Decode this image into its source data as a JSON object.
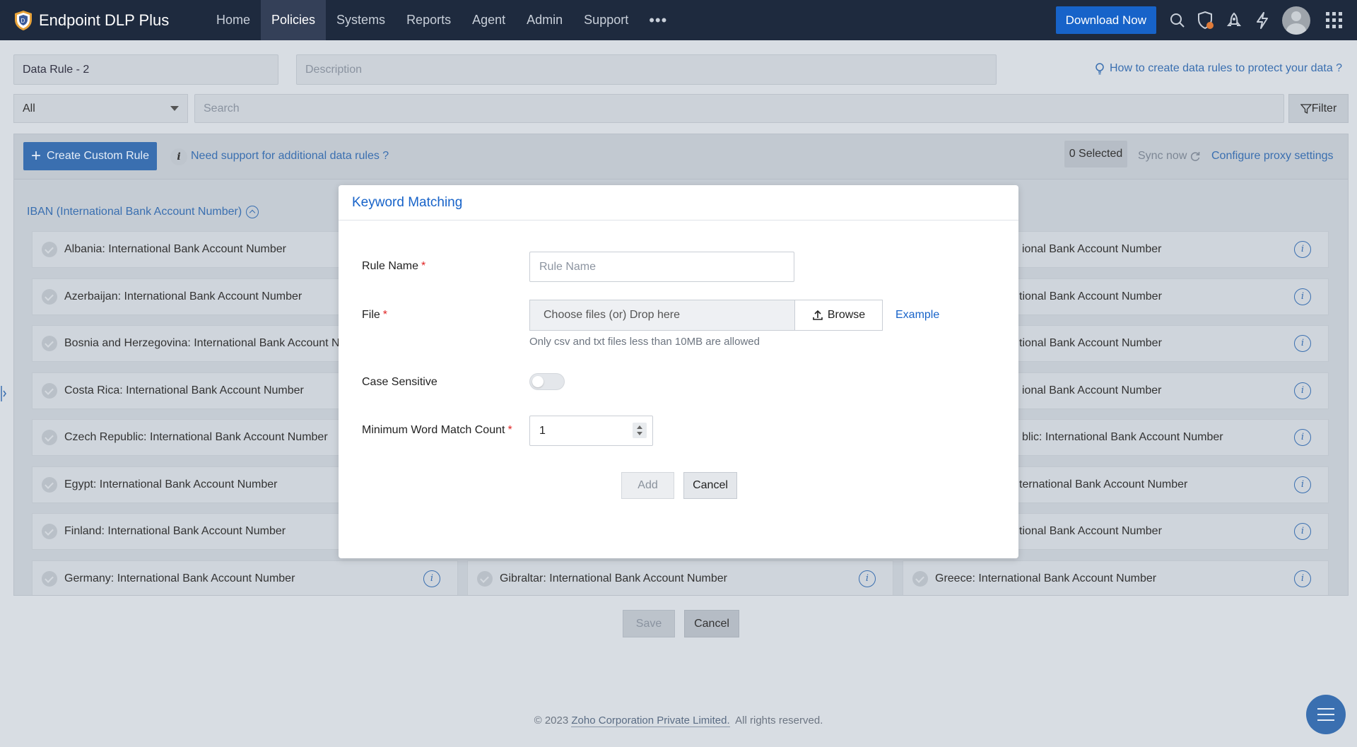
{
  "app": {
    "name": "Endpoint DLP Plus",
    "nav": [
      "Home",
      "Policies",
      "Systems",
      "Reports",
      "Agent",
      "Admin",
      "Support"
    ],
    "active_nav": "Policies",
    "more_label": "•••",
    "download_label": "Download Now",
    "icons": [
      "search-icon",
      "shield-alert-icon",
      "rocket-icon",
      "lightning-icon",
      "avatar",
      "app-grid-icon"
    ]
  },
  "rule_form": {
    "rule_name_value": "Data Rule - 2",
    "description_placeholder": "Description",
    "help_link": "How to create data rules to protect your data ?",
    "category_select": "All",
    "search_placeholder": "Search",
    "filter_label": "Filter"
  },
  "rules_panel": {
    "create_label": "Create Custom Rule",
    "info_label": "i",
    "support_link": "Need support for additional data rules ?",
    "selected_count": "0 Selected",
    "sync_label": "Sync now",
    "proxy_link": "Configure proxy settings",
    "section_title": "IBAN (International Bank Account Number)",
    "left_column": [
      "Albania: International Bank Account Number",
      "Azerbaijan: International Bank Account Number",
      "Bosnia and Herzegovina: International Bank Account N",
      "Costa Rica: International Bank Account Number",
      "Czech Republic: International Bank Account Number",
      "Egypt: International Bank Account Number",
      "Finland: International Bank Account Number",
      "Germany: International Bank Account Number"
    ],
    "middle_column_visible": [
      "Gibraltar: International Bank Account Number"
    ],
    "right_column": [
      "ional Bank Account Number",
      "tional Bank Account Number",
      "tional Bank Account Number",
      "ional Bank Account Number",
      "blic: International Bank Account Number",
      "ternational Bank Account Number",
      "tional Bank Account Number",
      "Greece: International Bank Account Number"
    ]
  },
  "page_actions": {
    "save": "Save",
    "cancel": "Cancel"
  },
  "footer": {
    "prefix": "© 2023 ",
    "company": "Zoho Corporation Private Limited.",
    "suffix": "  All rights reserved."
  },
  "modal": {
    "title": "Keyword Matching",
    "rule_name_label": "Rule Name",
    "rule_name_placeholder": "Rule Name",
    "file_label": "File",
    "file_drop_text": "Choose files (or) Drop here",
    "browse_label": "Browse",
    "example_link": "Example",
    "file_hint": "Only csv and txt files less than 10MB are allowed",
    "case_sensitive_label": "Case Sensitive",
    "case_sensitive_on": false,
    "min_match_label": "Minimum Word Match Count",
    "min_match_value": "1",
    "required_mark": "*",
    "add_label": "Add",
    "cancel_label": "Cancel"
  },
  "colors": {
    "topbar": "#1e2a3e",
    "accent": "#1763c9",
    "required": "#e02424"
  }
}
